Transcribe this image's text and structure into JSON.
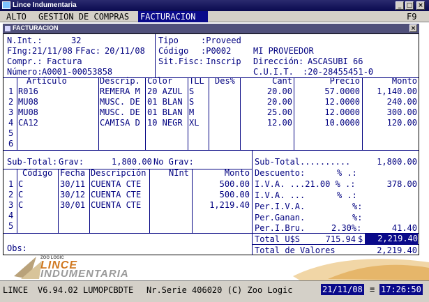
{
  "window": {
    "title": "Lince Indumentaria",
    "key_hint": "F9"
  },
  "menu": {
    "items": [
      "ALTO",
      "GESTION DE COMPRAS",
      "FACTURACION"
    ]
  },
  "form_title": "FACTURACION",
  "header": {
    "nint_label": "N.Int.:",
    "nint_value": "32",
    "fing_label": "FIng:",
    "fing_value": "21/11/08",
    "ffac_label": "FFac:",
    "ffac_value": "20/11/08",
    "compr_label": "Compr.:",
    "compr_value": "Factura",
    "numero_label": "Número:",
    "numero_value": "A0001-00053858",
    "tipo_label": "Tipo",
    "tipo_value": ":Proveed",
    "codigo_label": "Código",
    "codigo_value": ":P0002",
    "proveedor": "MI PROVEEDOR",
    "sitfisc_label": "Sit.Fisc:",
    "sitfisc_value": "Inscrip",
    "direccion_label": "Dirección:",
    "direccion_value": "ASCASUBI 66",
    "cuit_label": "C.U.I.T.",
    "cuit_value": ":20-28455451-0"
  },
  "items_table": {
    "headers": {
      "articulo": "Artículo",
      "descrip": "Descrip.",
      "color": "Color",
      "tll": "TLL",
      "des": "Des%",
      "cant": "Cant",
      "precio": "Precio",
      "monto": "Monto"
    },
    "rows": [
      {
        "n": "1",
        "articulo": "R016",
        "descrip": "REMERA M",
        "color": "20 AZUL",
        "tll": "S",
        "cant": "20.00",
        "precio": "57.0000",
        "monto": "1,140.00"
      },
      {
        "n": "2",
        "articulo": "MU08",
        "descrip": "MUSC. DE",
        "color": "01 BLAN",
        "tll": "S",
        "cant": "20.00",
        "precio": "12.0000",
        "monto": "240.00"
      },
      {
        "n": "3",
        "articulo": "MU08",
        "descrip": "MUSC. DE",
        "color": "01 BLAN",
        "tll": "M",
        "cant": "25.00",
        "precio": "12.0000",
        "monto": "300.00"
      },
      {
        "n": "4",
        "articulo": "CA12",
        "descrip": "CAMISA D",
        "color": "10 NEGR",
        "tll": "XL",
        "cant": "12.00",
        "precio": "10.0000",
        "monto": "120.00"
      },
      {
        "n": "5",
        "articulo": "",
        "descrip": "",
        "color": "",
        "tll": "",
        "cant": "",
        "precio": "",
        "monto": ""
      },
      {
        "n": "6",
        "articulo": "",
        "descrip": "",
        "color": "",
        "tll": "",
        "cant": "",
        "precio": "",
        "monto": ""
      }
    ]
  },
  "subtotal_line": {
    "label": "Sub-Total:",
    "grav_label": "Grav:",
    "grav_value": "1,800.00",
    "nograv_label": "No Grav:"
  },
  "values_table": {
    "headers": {
      "codigo": "Código",
      "fecha": "Fecha",
      "descripcion": "Descripción",
      "nint": "NInt",
      "monto": "Monto"
    },
    "rows": [
      {
        "n": "1",
        "codigo": "C",
        "fecha": "30/11",
        "descripcion": "CUENTA CTE",
        "monto": "500.00"
      },
      {
        "n": "2",
        "codigo": "C",
        "fecha": "30/12",
        "descripcion": "CUENTA CTE",
        "monto": "500.00"
      },
      {
        "n": "3",
        "codigo": "C",
        "fecha": "30/01",
        "descripcion": "CUENTA CTE",
        "monto": "1,219.40"
      },
      {
        "n": "4",
        "codigo": "",
        "fecha": "",
        "descripcion": "",
        "monto": ""
      },
      {
        "n": "5",
        "codigo": "",
        "fecha": "",
        "descripcion": "",
        "monto": ""
      }
    ]
  },
  "obs_label": "Obs:",
  "totals": {
    "subtotal": {
      "label": "Sub-Total..........",
      "value": "1,800.00"
    },
    "descuento": {
      "label": "Descuento:",
      "pct": "% .:",
      "value": ""
    },
    "iva1": {
      "label": "I.V.A. ...21.00 % .:",
      "value": "378.00"
    },
    "iva2": {
      "label": "I.V.A. ...",
      "pct": "% .:",
      "value": ""
    },
    "periva": {
      "label": "Per.I.V.A.",
      "pct": "%:",
      "value": ""
    },
    "perganan": {
      "label": "Per.Ganan.",
      "pct": "%:",
      "value": ""
    },
    "peribru": {
      "label": "Per.I.Bru.",
      "pct": "2.30%:",
      "value": "41.40"
    },
    "total_uss": {
      "label": "Total U$S",
      "value": "715.94",
      "currency": "$",
      "total": "2,219.40"
    },
    "total_valores": {
      "label": "Total de Valores",
      "value": "2,219.40"
    }
  },
  "brand": {
    "small": "ZOO LOGIC",
    "line1": "LINCE",
    "line2": "INDUMENTARIA"
  },
  "status": {
    "app": "LINCE",
    "version": "V6.94.02 LUMOPCBDTE",
    "serial": "Nr.Serie 406020 (C) Zoo Logic",
    "date": "21/11/08",
    "time": "17:26:50"
  },
  "colors": {
    "text": "#000080",
    "highlight": "#0a0a8a",
    "chrome": "#d4d0c8"
  }
}
